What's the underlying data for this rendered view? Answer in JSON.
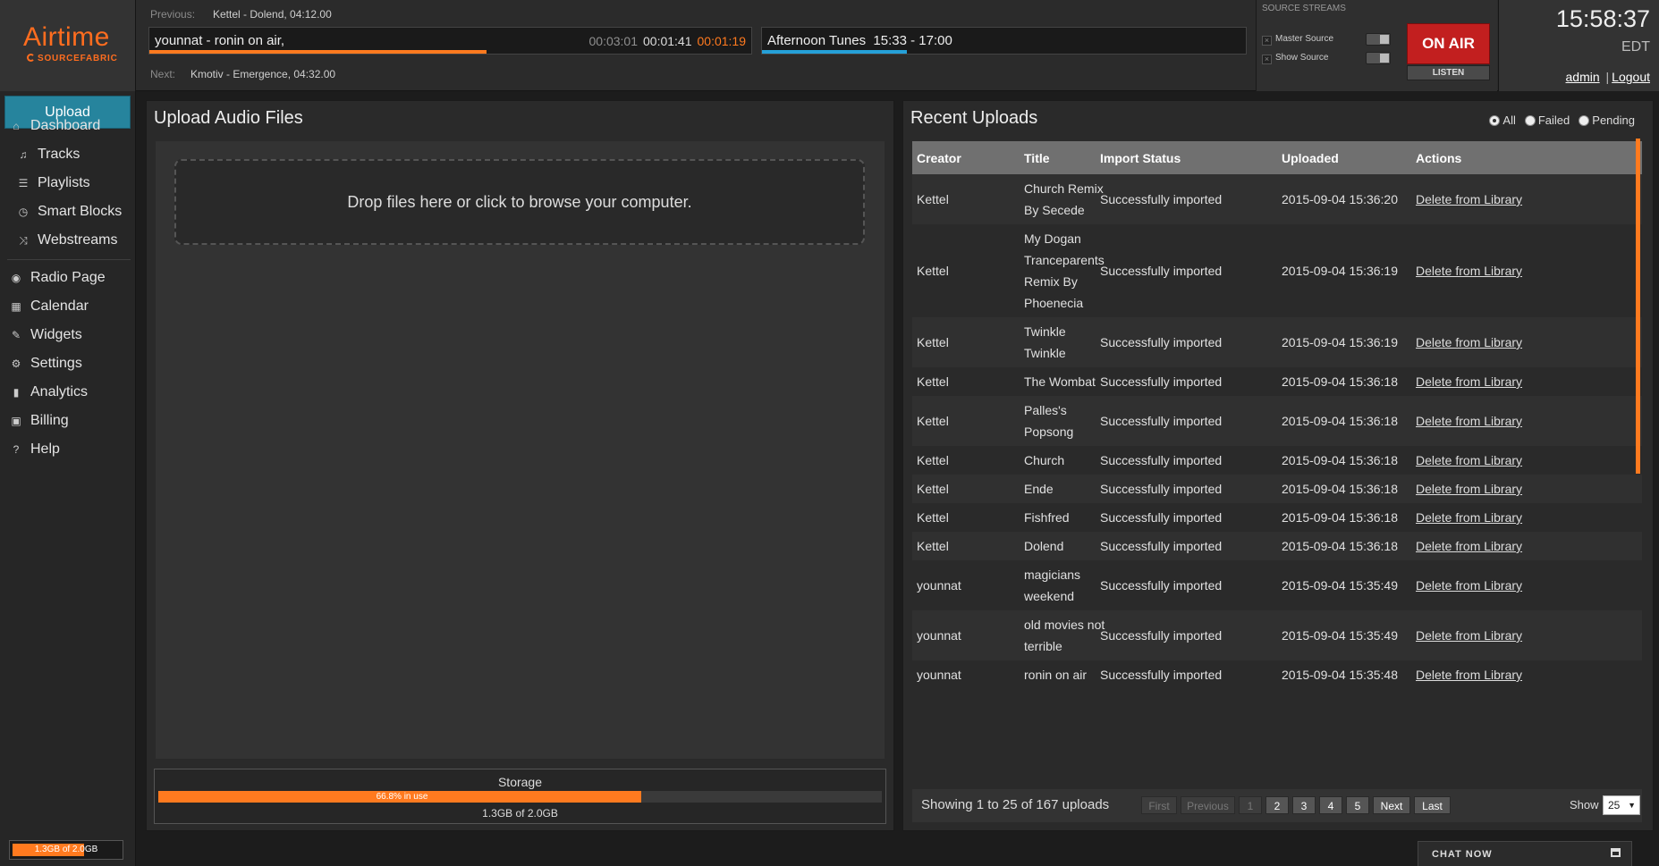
{
  "app": {
    "brand": "Airtime",
    "brand_sub": "SOURCEFABRIC"
  },
  "header": {
    "previous_label": "Previous:",
    "previous_value": "Kettel - Dolend, 04:12.00",
    "next_label": "Next:",
    "next_value": "Kmotiv - Emergence, 04:32.00",
    "current_track": "younnat - ronin on air,",
    "elapsed": "00:03:01",
    "position": "00:01:41",
    "remaining": "00:01:19",
    "track_progress": 0.56,
    "current_show": "Afternoon Tunes",
    "show_time": "15:33 - 17:00",
    "show_progress": 0.3,
    "source_streams_label": "SOURCE STREAMS",
    "master_source": "Master Source",
    "show_source": "Show Source",
    "on_air": "ON AIR",
    "listen": "LISTEN",
    "clock": "15:58:37",
    "timezone": "EDT",
    "user": "admin",
    "separator": "|",
    "logout": "Logout"
  },
  "sidebar": {
    "upload": "Upload",
    "items": [
      {
        "label": "Dashboard",
        "icon": "home-icon",
        "glyph": "⌂"
      },
      {
        "label": "Tracks",
        "icon": "music-note-icon",
        "glyph": "♫"
      },
      {
        "label": "Playlists",
        "icon": "list-icon",
        "glyph": "☰"
      },
      {
        "label": "Smart Blocks",
        "icon": "clock-icon",
        "glyph": "◷"
      },
      {
        "label": "Webstreams",
        "icon": "shuffle-icon",
        "glyph": "⤨"
      },
      {
        "label": "Radio Page",
        "icon": "globe-icon",
        "glyph": "◉"
      },
      {
        "label": "Calendar",
        "icon": "calendar-icon",
        "glyph": "▦"
      },
      {
        "label": "Widgets",
        "icon": "wrench-icon",
        "glyph": "✎"
      },
      {
        "label": "Settings",
        "icon": "gear-icon",
        "glyph": "⚙"
      },
      {
        "label": "Analytics",
        "icon": "bar-chart-icon",
        "glyph": "▮"
      },
      {
        "label": "Billing",
        "icon": "briefcase-icon",
        "glyph": "▣"
      },
      {
        "label": "Help",
        "icon": "help-icon",
        "glyph": "?"
      }
    ],
    "storage_text": "1.3GB of 2.0GB",
    "storage_fraction": 0.668
  },
  "upload_panel": {
    "title": "Upload Audio Files",
    "drop_text": "Drop files here or click to browse your computer.",
    "storage_label": "Storage",
    "storage_pct_text": "66.8% in use",
    "storage_fraction": 0.668,
    "storage_size": "1.3GB of 2.0GB"
  },
  "recent": {
    "title": "Recent Uploads",
    "filters": [
      "All",
      "Failed",
      "Pending"
    ],
    "selected_filter": "All",
    "columns": [
      "Creator",
      "Title",
      "Import Status",
      "Uploaded",
      "Actions"
    ],
    "rows": [
      {
        "creator": "Kettel",
        "title": "Church Remix By Secede",
        "status": "Successfully imported",
        "uploaded": "2015-09-04 15:36:20",
        "action": "Delete from Library"
      },
      {
        "creator": "Kettel",
        "title": "My Dogan Tranceparents Remix By Phoenecia",
        "status": "Successfully imported",
        "uploaded": "2015-09-04 15:36:19",
        "action": "Delete from Library"
      },
      {
        "creator": "Kettel",
        "title": "Twinkle Twinkle",
        "status": "Successfully imported",
        "uploaded": "2015-09-04 15:36:19",
        "action": "Delete from Library"
      },
      {
        "creator": "Kettel",
        "title": "The Wombat",
        "status": "Successfully imported",
        "uploaded": "2015-09-04 15:36:18",
        "action": "Delete from Library"
      },
      {
        "creator": "Kettel",
        "title": "Palles's Popsong",
        "status": "Successfully imported",
        "uploaded": "2015-09-04 15:36:18",
        "action": "Delete from Library"
      },
      {
        "creator": "Kettel",
        "title": "Church",
        "status": "Successfully imported",
        "uploaded": "2015-09-04 15:36:18",
        "action": "Delete from Library"
      },
      {
        "creator": "Kettel",
        "title": "Ende",
        "status": "Successfully imported",
        "uploaded": "2015-09-04 15:36:18",
        "action": "Delete from Library"
      },
      {
        "creator": "Kettel",
        "title": "Fishfred",
        "status": "Successfully imported",
        "uploaded": "2015-09-04 15:36:18",
        "action": "Delete from Library"
      },
      {
        "creator": "Kettel",
        "title": "Dolend",
        "status": "Successfully imported",
        "uploaded": "2015-09-04 15:36:18",
        "action": "Delete from Library"
      },
      {
        "creator": "younnat",
        "title": "magicians weekend",
        "status": "Successfully imported",
        "uploaded": "2015-09-04 15:35:49",
        "action": "Delete from Library"
      },
      {
        "creator": "younnat",
        "title": "old movies not terrible",
        "status": "Successfully imported",
        "uploaded": "2015-09-04 15:35:49",
        "action": "Delete from Library"
      },
      {
        "creator": "younnat",
        "title": "ronin on air",
        "status": "Successfully imported",
        "uploaded": "2015-09-04 15:35:48",
        "action": "Delete from Library"
      }
    ],
    "showing": "Showing 1 to 25 of 167 uploads",
    "pager": [
      "First",
      "Previous",
      "1",
      "2",
      "3",
      "4",
      "5",
      "Next",
      "Last"
    ],
    "current_page": "1",
    "show_label": "Show",
    "page_size": "25"
  },
  "chat": {
    "label": "CHAT NOW"
  },
  "colors": {
    "accent": "#ff7a1f",
    "upload_button": "#26849d",
    "on_air": "#c21f1f"
  }
}
